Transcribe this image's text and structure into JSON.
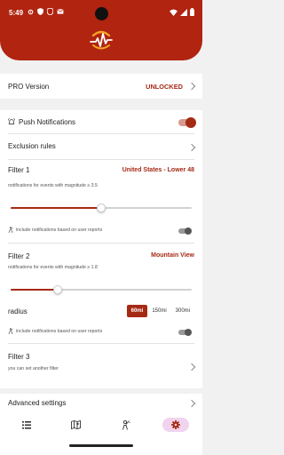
{
  "status_bar": {
    "time": "5:49",
    "icons": [
      "gear-icon",
      "shield-icon",
      "play-protect-icon",
      "mail-icon",
      "wifi-icon",
      "signal-icon",
      "battery-icon"
    ]
  },
  "app": {
    "logo": "seismograph-logo-icon",
    "accent_color": "#b02410"
  },
  "pro": {
    "label": "PRO Version",
    "value": "UNLOCKED"
  },
  "notifications": {
    "label": "Push Notifications",
    "enabled": true,
    "exclusion_label": "Exclusion rules"
  },
  "filter1": {
    "title": "Filter 1",
    "region": "United States - Lower 48",
    "description": "notifications for events with magnitude ≥ 3.5",
    "slider_fraction": 0.5,
    "user_reports_label": "include notifications based on user reports",
    "user_reports_enabled": false
  },
  "filter2": {
    "title": "Filter 2",
    "region": "Mountain View",
    "description": "notifications for events with magnitude ≥ 1.8",
    "slider_fraction": 0.26,
    "radius_label": "radius",
    "radius_options": [
      "60mi",
      "150mi",
      "300mi"
    ],
    "radius_selected": "60mi",
    "user_reports_label": "include notifications based on user reports",
    "user_reports_enabled": false
  },
  "filter3": {
    "title": "Filter 3",
    "description": "you can set another filter"
  },
  "advanced": {
    "label": "Advanced settings"
  },
  "bottom_nav": {
    "items": [
      "list-icon",
      "map-icon",
      "user-report-icon",
      "settings-icon"
    ],
    "active": "settings-icon"
  }
}
